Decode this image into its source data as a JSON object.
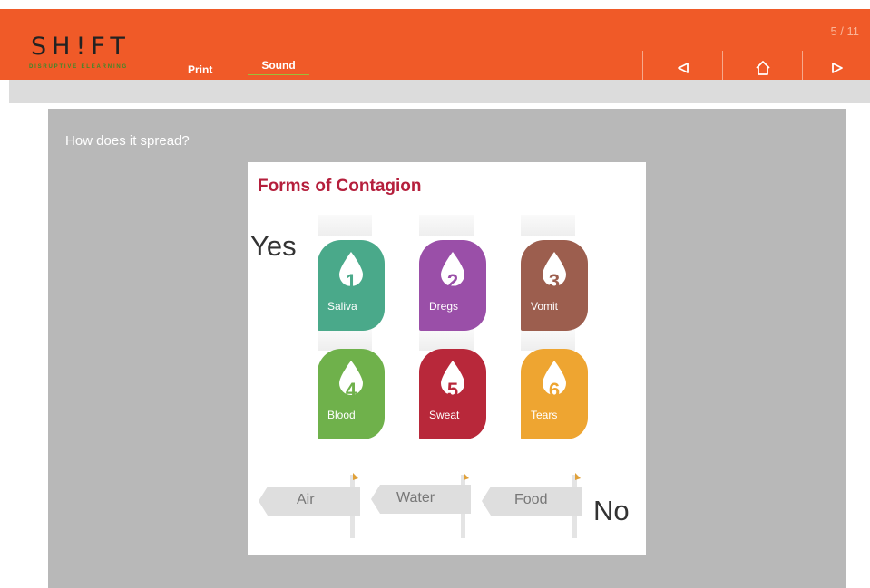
{
  "header": {
    "logo": "SH!FT",
    "tagline": "DISRUPTIVE ELEARNING",
    "print_label": "Print",
    "sound_label": "Sound",
    "page_counter": "5 / 11",
    "accent_color": "#f05a28"
  },
  "controls": {
    "prev_icon": "triangle-left-icon",
    "home_icon": "home-icon",
    "next_icon": "triangle-right-icon"
  },
  "slide": {
    "question": "How does it spread?",
    "card_title": "Forms of Contagion",
    "yes_label": "Yes",
    "no_label": "No",
    "forms": [
      {
        "number": "1",
        "label": "Saliva",
        "color": "#4aa98a"
      },
      {
        "number": "2",
        "label": "Dregs",
        "color": "#9a4fa8"
      },
      {
        "number": "3",
        "label": "Vomit",
        "color": "#9c5e4e"
      },
      {
        "number": "4",
        "label": "Blood",
        "color": "#6fb14b"
      },
      {
        "number": "5",
        "label": "Sweat",
        "color": "#b8283a"
      },
      {
        "number": "6",
        "label": "Tears",
        "color": "#eea531"
      }
    ],
    "signs": [
      "Air",
      "Water",
      "Food"
    ]
  }
}
